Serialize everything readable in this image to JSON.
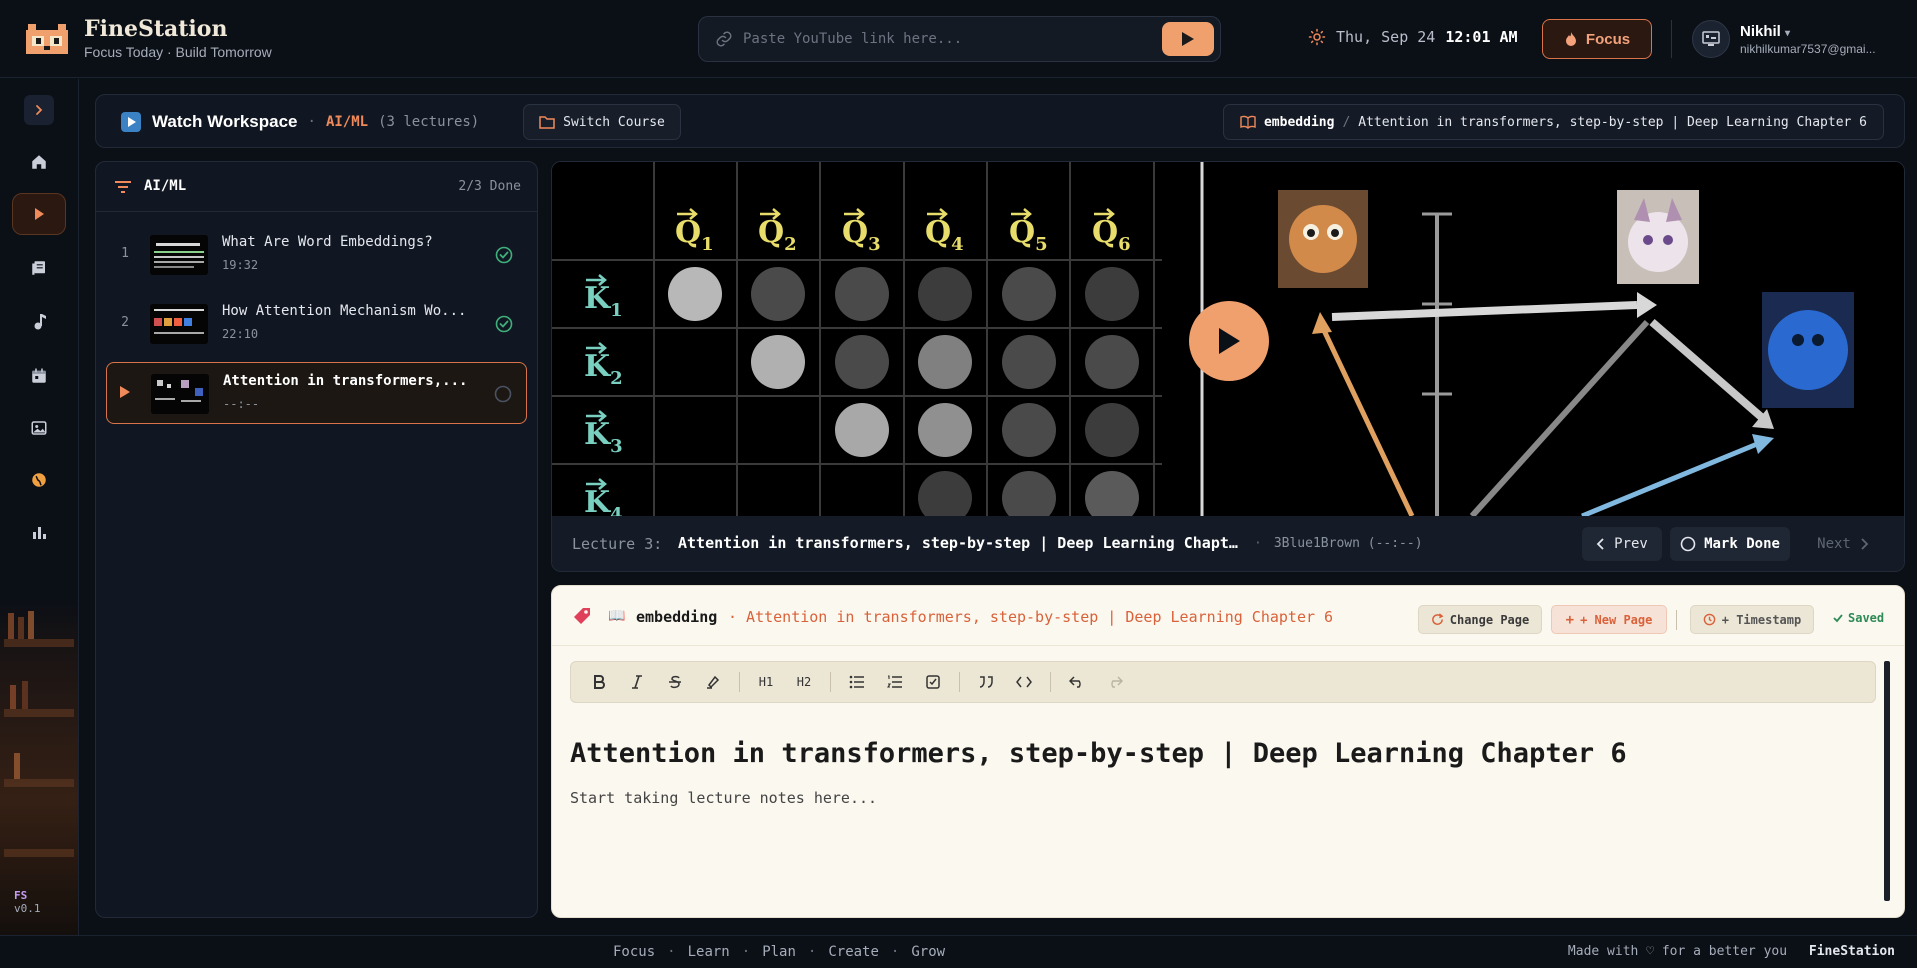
{
  "brand": {
    "title": "FineStation",
    "subtitle": "Focus Today · Build Tomorrow"
  },
  "header": {
    "youtube_placeholder": "Paste YouTube link here...",
    "date": "Thu, Sep 24",
    "time": "12:01 AM",
    "focus_label": "Focus",
    "user_name": "Nikhil",
    "user_email": "nikhilkumar7537@gmai..."
  },
  "rail": {
    "brand_short": "FS",
    "version": "v0.1"
  },
  "workspace": {
    "title": "Watch Workspace",
    "course": "AI/ML",
    "lecture_count": "(3 lectures)",
    "switch_label": "Switch Course",
    "crumb_page": "embedding",
    "crumb_sep": "/",
    "crumb_lecture": "Attention in transformers, step-by-step | Deep Learning Chapter 6"
  },
  "lecture_list": {
    "course": "AI/ML",
    "progress": "2/3 Done",
    "items": [
      {
        "num": "1",
        "title": "What Are Word Embeddings?",
        "duration": "19:32",
        "done": true
      },
      {
        "num": "2",
        "title": "How Attention Mechanism Wo...",
        "duration": "22:10",
        "done": true
      },
      {
        "num": "",
        "title": "Attention in transformers,...",
        "duration": "--:--",
        "done": false
      }
    ]
  },
  "video": {
    "lecture_label": "Lecture 3:",
    "lecture_title": "Attention in transformers, step-by-step | Deep Learning Chapt…",
    "channel": "3Blue1Brown (--:--)",
    "prev_label": "Prev",
    "mark_done_label": "Mark Done",
    "next_label": "Next",
    "q_labels": [
      "Q1",
      "Q2",
      "Q3",
      "Q4",
      "Q5",
      "Q6"
    ],
    "k_labels": [
      "K1",
      "K2",
      "K3",
      "K4"
    ]
  },
  "notes": {
    "book_icon": "📖",
    "page_name": "embedding",
    "lecture_title": "· Attention in transformers, step-by-step | Deep Learning Chapter 6",
    "change_page_label": "Change Page",
    "new_page_label": "+ New Page",
    "timestamp_label": "+ Timestamp",
    "saved_label": "Saved",
    "heading": "Attention in transformers, step-by-step | Deep Learning Chapter 6",
    "placeholder": "Start taking lecture notes here..."
  },
  "toolbar": {
    "h1": "H1",
    "h2": "H2"
  },
  "footer": {
    "nav": [
      "Focus",
      "Learn",
      "Plan",
      "Create",
      "Grow"
    ],
    "tagline": "Made with ♡ for a better you",
    "brand": "FineStation"
  },
  "colors": {
    "accent": "#f0a06d",
    "accent_dark": "#d9744a",
    "bg": "#0b0f16",
    "panel": "#111722",
    "notes_bg": "#fbf8ef",
    "success": "#3fb07a"
  }
}
